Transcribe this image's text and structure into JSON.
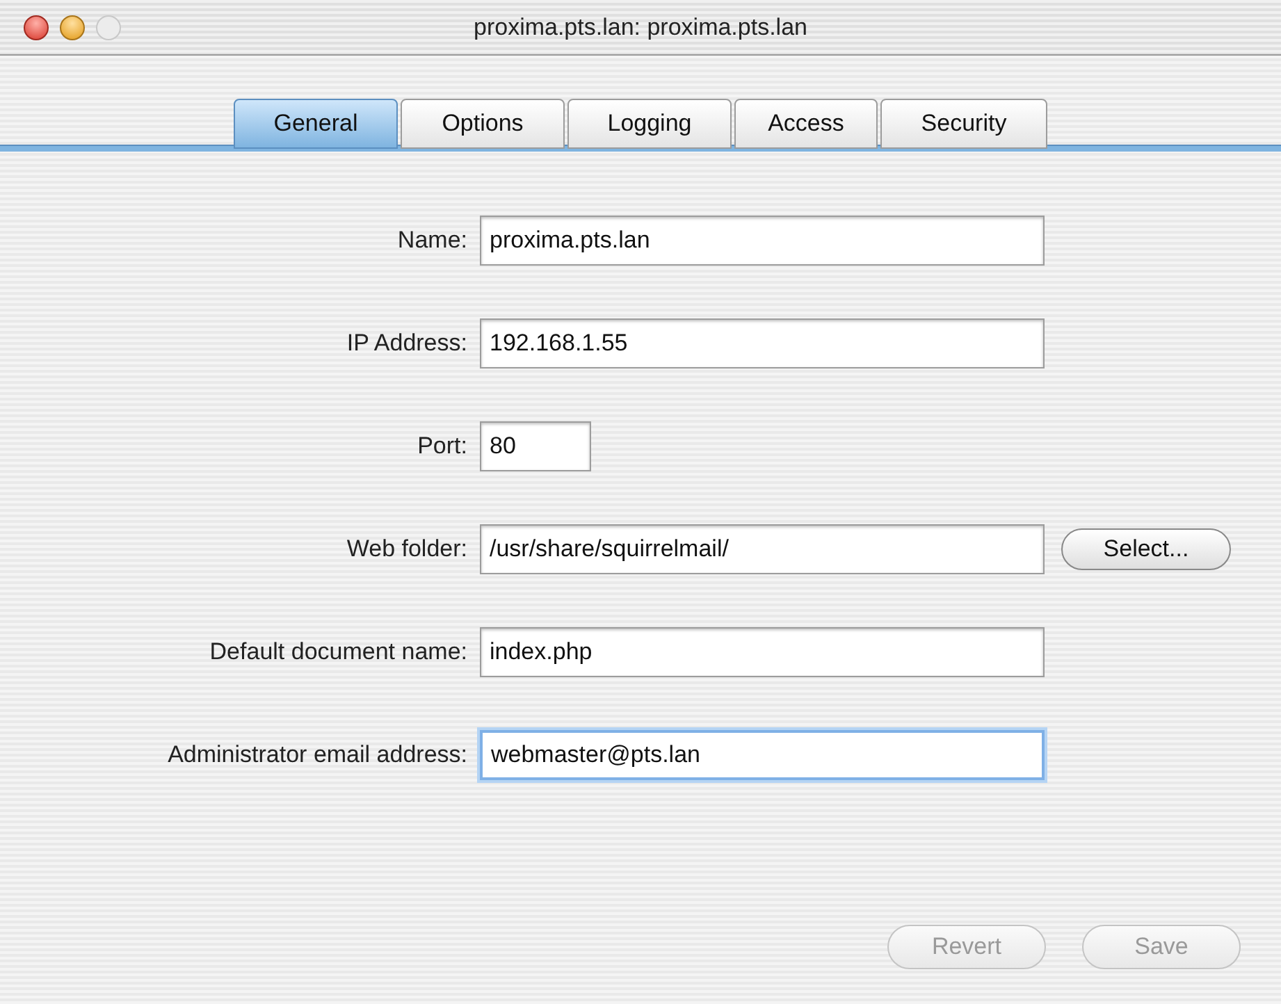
{
  "window": {
    "title": "proxima.pts.lan: proxima.pts.lan"
  },
  "tabs": [
    {
      "label": "General",
      "selected": true
    },
    {
      "label": "Options",
      "selected": false
    },
    {
      "label": "Logging",
      "selected": false
    },
    {
      "label": "Access",
      "selected": false
    },
    {
      "label": "Security",
      "selected": false
    }
  ],
  "fields": [
    {
      "kind": "text",
      "label": "Name:",
      "value": "proxima.pts.lan",
      "focused": false
    },
    {
      "kind": "text",
      "label": "IP Address:",
      "value": "192.168.1.55",
      "focused": false
    },
    {
      "kind": "number",
      "label": "Port:",
      "value": "80",
      "focused": false
    },
    {
      "kind": "text",
      "label": "Web folder:",
      "value": "/usr/share/squirrelmail/",
      "focused": false,
      "button": {
        "label": "Select...",
        "disabled": false
      }
    },
    {
      "kind": "text",
      "label": "Default document name:",
      "value": "index.php",
      "focused": false
    },
    {
      "kind": "text",
      "label": "Administrator email address:",
      "value": "webmaster@pts.lan",
      "focused": true
    }
  ],
  "buttons": [
    {
      "label": "Revert",
      "disabled": true
    },
    {
      "label": "Save",
      "disabled": true
    }
  ]
}
